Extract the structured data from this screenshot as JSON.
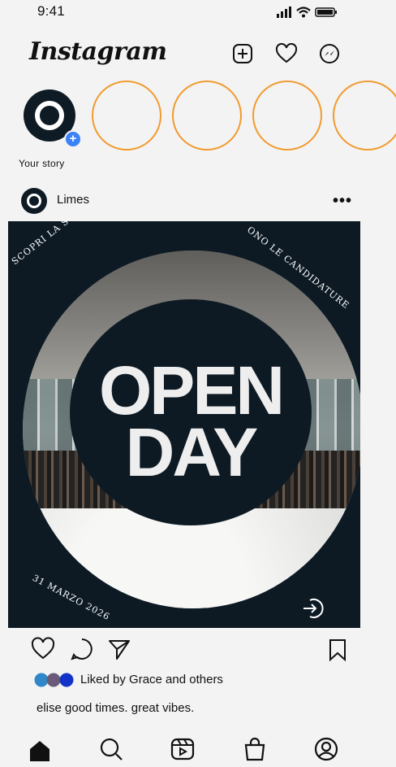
{
  "status_bar": {
    "time": "9:41",
    "icons": [
      "signal-icon",
      "wifi-icon",
      "battery-icon"
    ]
  },
  "header": {
    "logo": "Instagram",
    "icons": [
      "new-post-icon",
      "heart-icon",
      "messenger-icon"
    ]
  },
  "stories": {
    "your_story_label": "Your story",
    "count_rings": 4
  },
  "post": {
    "username": "Limes",
    "more": "•••",
    "image": {
      "headline_line1": "OPEN",
      "headline_line2": "DAY",
      "curved_text_top_left": "SCOPRI LA SCUOLA E",
      "curved_text_top_right": "ONO LE CANDIDATURE",
      "curved_text_bottom": "31 MARZO 2026"
    },
    "likes_text": "Liked by Grace and others",
    "caption": "elise good times. great vibes."
  },
  "colors": {
    "story_ring": "#f29a2e",
    "navy": "#0d1a24",
    "badge_blue": "#3b82f6",
    "background": "#f3f3f3"
  },
  "bottom_nav": [
    "home-icon",
    "search-icon",
    "reels-icon",
    "shop-icon",
    "profile-icon"
  ]
}
